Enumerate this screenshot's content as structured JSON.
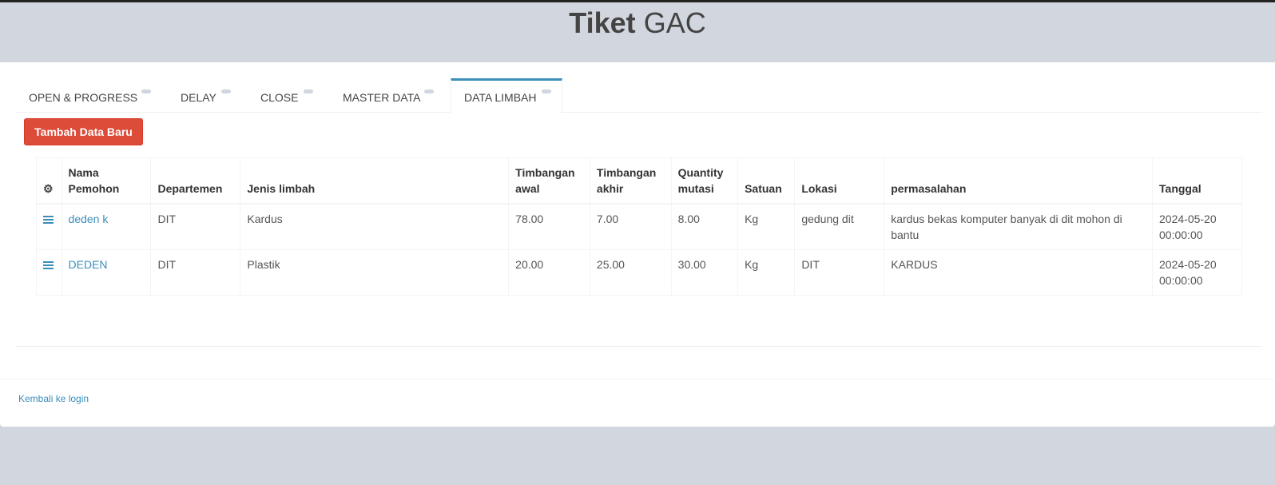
{
  "header": {
    "title_bold": "Tiket",
    "title_light": "GAC"
  },
  "tabs": [
    {
      "label": "OPEN & PROGRESS",
      "active": false
    },
    {
      "label": "DELAY",
      "active": false
    },
    {
      "label": "CLOSE",
      "active": false
    },
    {
      "label": "MASTER DATA",
      "active": false
    },
    {
      "label": "DATA LIMBAH",
      "active": true
    }
  ],
  "toolbar": {
    "add_label": "Tambah Data Baru"
  },
  "table": {
    "gear_icon": "gear-icon",
    "headers": {
      "nama": "Nama Pemohon",
      "departemen": "Departemen",
      "jenis": "Jenis limbah",
      "awal": "Timbangan awal",
      "akhir": "Timbangan akhir",
      "quantity": "Quantity mutasi",
      "satuan": "Satuan",
      "lokasi": "Lokasi",
      "permasalahan": "permasalahan",
      "tanggal": "Tanggal"
    },
    "rows": [
      {
        "nama": "deden k",
        "departemen": "DIT",
        "jenis": "Kardus",
        "awal": "78.00",
        "akhir": "7.00",
        "quantity": "8.00",
        "satuan": "Kg",
        "lokasi": "gedung dit",
        "permasalahan": "kardus bekas komputer banyak di dit mohon di bantu",
        "tanggal": "2024-05-20 00:00:00"
      },
      {
        "nama": "DEDEN",
        "departemen": "DIT",
        "jenis": "Plastik",
        "awal": "20.00",
        "akhir": "25.00",
        "quantity": "30.00",
        "satuan": "Kg",
        "lokasi": "DIT",
        "permasalahan": "KARDUS",
        "tanggal": "2024-05-20 00:00:00"
      }
    ]
  },
  "footer": {
    "back_label": "Kembali ke login"
  },
  "colors": {
    "accent": "#3c8dbc",
    "danger": "#dd4b39",
    "page_bg": "#d2d6de"
  }
}
